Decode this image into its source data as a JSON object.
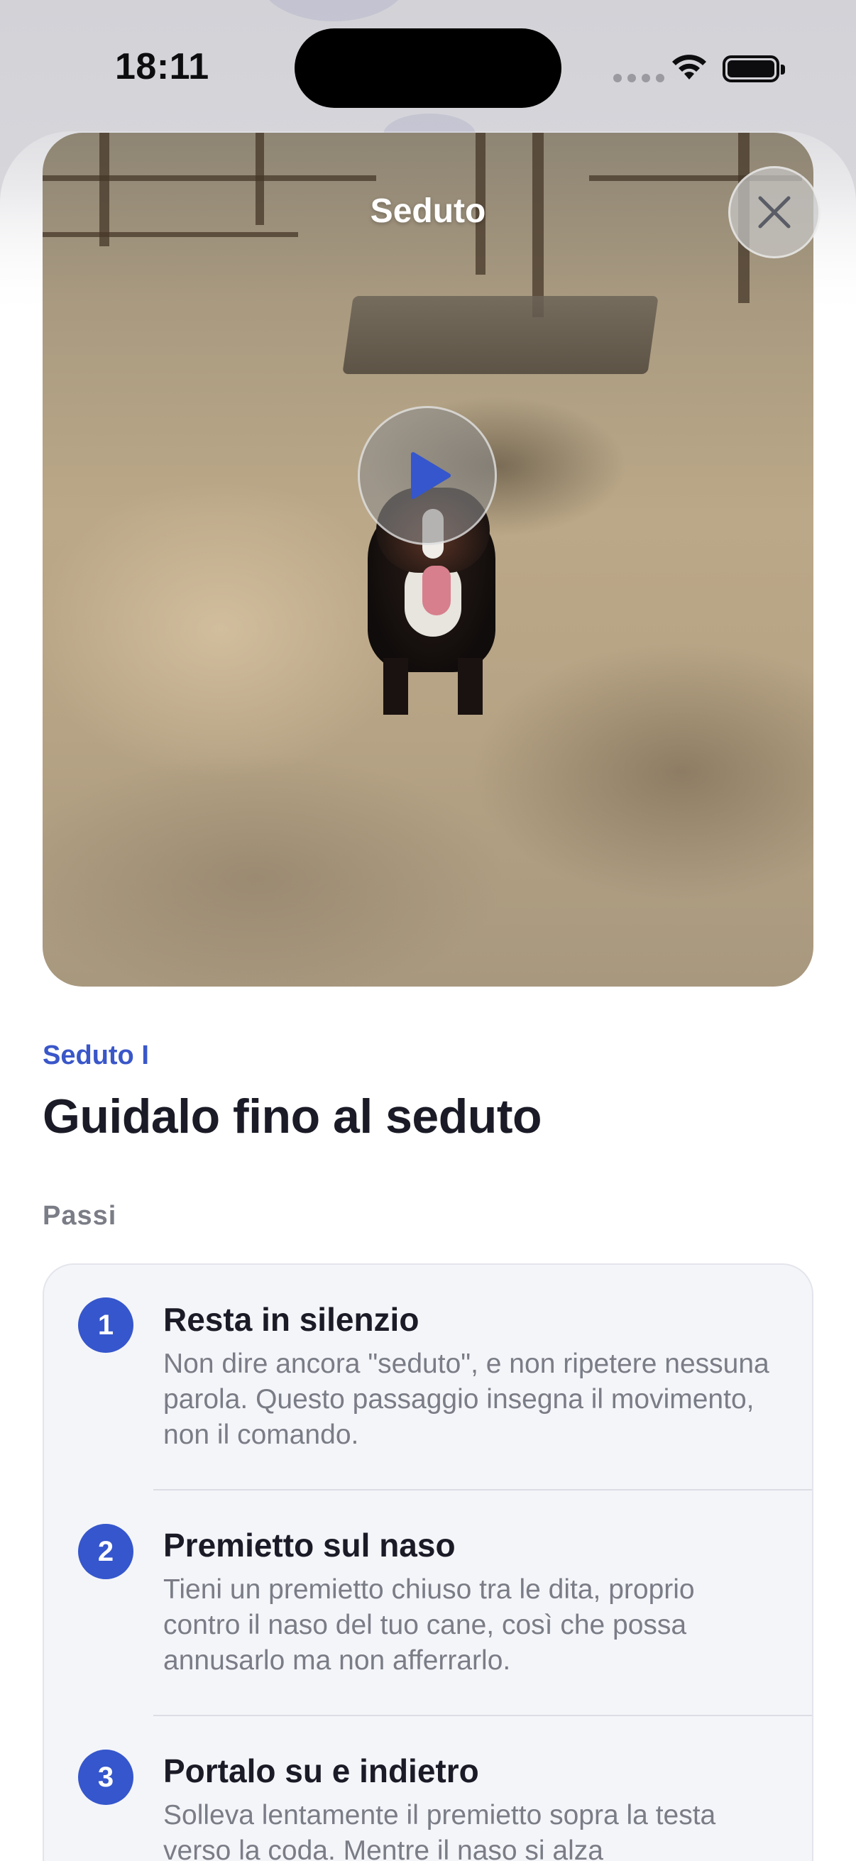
{
  "status_bar": {
    "time": "18:11",
    "icons": [
      "signal-dots-icon",
      "wifi-icon",
      "battery-icon"
    ]
  },
  "video": {
    "title": "Seduto",
    "close_icon": "close-icon",
    "play_icon": "play-icon"
  },
  "lesson": {
    "eyebrow": "Seduto I",
    "title": "Guidalo fino al seduto",
    "steps_label": "Passi"
  },
  "steps": [
    {
      "number": "1",
      "title": "Resta in silenzio",
      "description": "Non dire ancora \"seduto\", e non ripetere nessuna parola. Questo passaggio insegna il movimento, non il comando."
    },
    {
      "number": "2",
      "title": "Premietto sul naso",
      "description": "Tieni un premietto chiuso tra le dita, proprio contro il naso del tuo cane, così che possa annusarlo ma non afferrarlo."
    },
    {
      "number": "3",
      "title": "Portalo su e indietro",
      "description": "Solleva lentamente il premietto sopra la testa verso la coda. Mentre il naso si alza"
    }
  ],
  "colors": {
    "accent": "#3556cc",
    "eyebrow": "#3a57c9",
    "card_background": "#f4f5f9",
    "secondary_text": "#7a7c86"
  }
}
